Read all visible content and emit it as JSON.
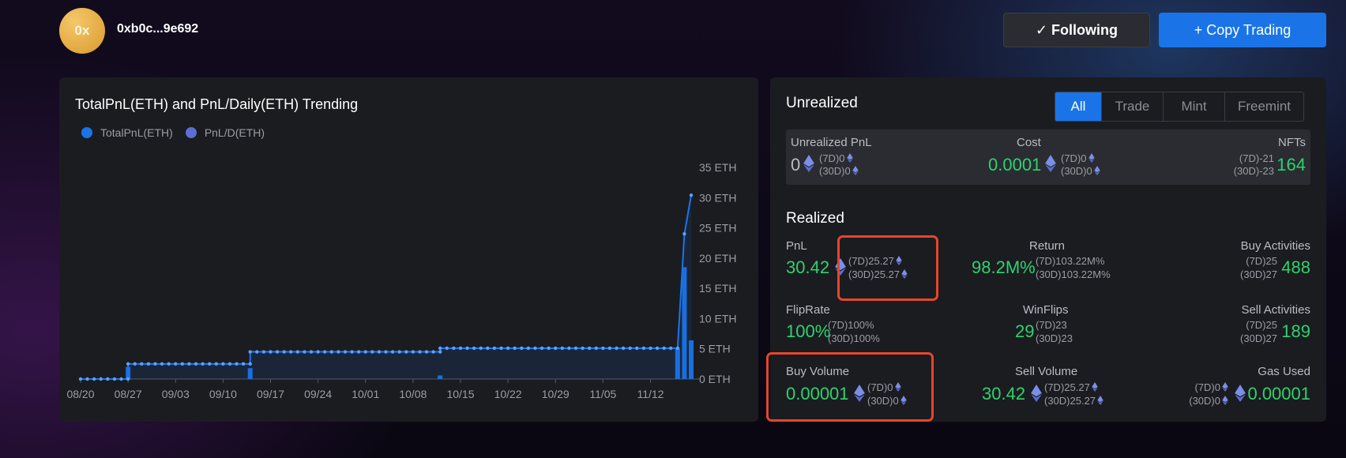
{
  "header": {
    "avatar_text": "0x",
    "address": "0xb0c...9e692",
    "following_label": "✓ Following",
    "copy_label": "+ Copy Trading"
  },
  "chart": {
    "title": "TotalPnL(ETH) and PnL/Daily(ETH) Trending",
    "legend": [
      "TotalPnL(ETH)",
      "PnL/D(ETH)"
    ]
  },
  "chart_data": {
    "type": "line",
    "title": "TotalPnL(ETH) and PnL/Daily(ETH) Trending",
    "x_ticks": [
      "08/20",
      "08/27",
      "09/03",
      "09/10",
      "09/17",
      "09/24",
      "10/01",
      "10/08",
      "10/15",
      "10/22",
      "10/29",
      "11/05",
      "11/12"
    ],
    "y_ticks": [
      "0 ETH",
      "5 ETH",
      "10 ETH",
      "15 ETH",
      "20 ETH",
      "25 ETH",
      "30 ETH",
      "35 ETH"
    ],
    "ylim": [
      0,
      35
    ],
    "series": [
      {
        "name": "TotalPnL(ETH)",
        "color": "#1a74e8",
        "segments": [
          {
            "from": "08/20",
            "to": "08/27",
            "value": 0
          },
          {
            "from": "08/27",
            "to": "09/14",
            "value": 2.5
          },
          {
            "from": "09/14",
            "to": "10/12",
            "value": 4.5
          },
          {
            "from": "10/12",
            "to": "11/16",
            "value": 5.1
          }
        ],
        "end_points": [
          {
            "x": "11/17",
            "value": 24
          },
          {
            "x": "11/18",
            "value": 30.4
          }
        ]
      },
      {
        "name": "PnL/D(ETH)",
        "color": "#5a6fd0",
        "bars": [
          {
            "x": "08/27",
            "value": 2.0
          },
          {
            "x": "09/14",
            "value": 1.8
          },
          {
            "x": "10/12",
            "value": 0.6
          },
          {
            "x": "11/16",
            "value": 5.1
          },
          {
            "x": "11/17",
            "value": 18.5
          },
          {
            "x": "11/18",
            "value": 6.4
          }
        ]
      }
    ],
    "legend_position": "top-left"
  },
  "stats": {
    "unrealized_title": "Unrealized",
    "tabs": [
      "All",
      "Trade",
      "Mint",
      "Freemint"
    ],
    "unrealized": {
      "pnl_label": "Unrealized PnL",
      "pnl_value": "0",
      "pnl_7d": "(7D)0",
      "pnl_30d": "(30D)0",
      "cost_label": "Cost",
      "cost_value": "0.0001",
      "cost_7d": "(7D)0",
      "cost_30d": "(30D)0",
      "nfts_label": "NFTs",
      "nfts_value": "164",
      "nfts_7d": "(7D)-21",
      "nfts_30d": "(30D)-23"
    },
    "realized_title": "Realized",
    "realized": {
      "pnl_label": "PnL",
      "pnl_value": "30.42",
      "pnl_7d": "(7D)25.27",
      "pnl_30d": "(30D)25.27",
      "return_label": "Return",
      "return_value": "98.2M%",
      "return_7d": "(7D)103.22M%",
      "return_30d": "(30D)103.22M%",
      "buyact_label": "Buy Activities",
      "buyact_value": "488",
      "buyact_7d": "(7D)25",
      "buyact_30d": "(30D)27",
      "flip_label": "FlipRate",
      "flip_value": "100%",
      "flip_7d": "(7D)100%",
      "flip_30d": "(30D)100%",
      "win_label": "WinFlips",
      "win_value": "29",
      "win_7d": "(7D)23",
      "win_30d": "(30D)23",
      "sellact_label": "Sell Activities",
      "sellact_value": "189",
      "sellact_7d": "(7D)25",
      "sellact_30d": "(30D)27",
      "buyvol_label": "Buy Volume",
      "buyvol_value": "0.00001",
      "buyvol_7d": "(7D)0",
      "buyvol_30d": "(30D)0",
      "sellvol_label": "Sell Volume",
      "sellvol_value": "30.42",
      "sellvol_7d": "(7D)25.27",
      "sellvol_30d": "(30D)25.27",
      "gas_label": "Gas Used",
      "gas_value": "0.00001",
      "gas_7d": "(7D)0",
      "gas_30d": "(30D)0"
    }
  }
}
